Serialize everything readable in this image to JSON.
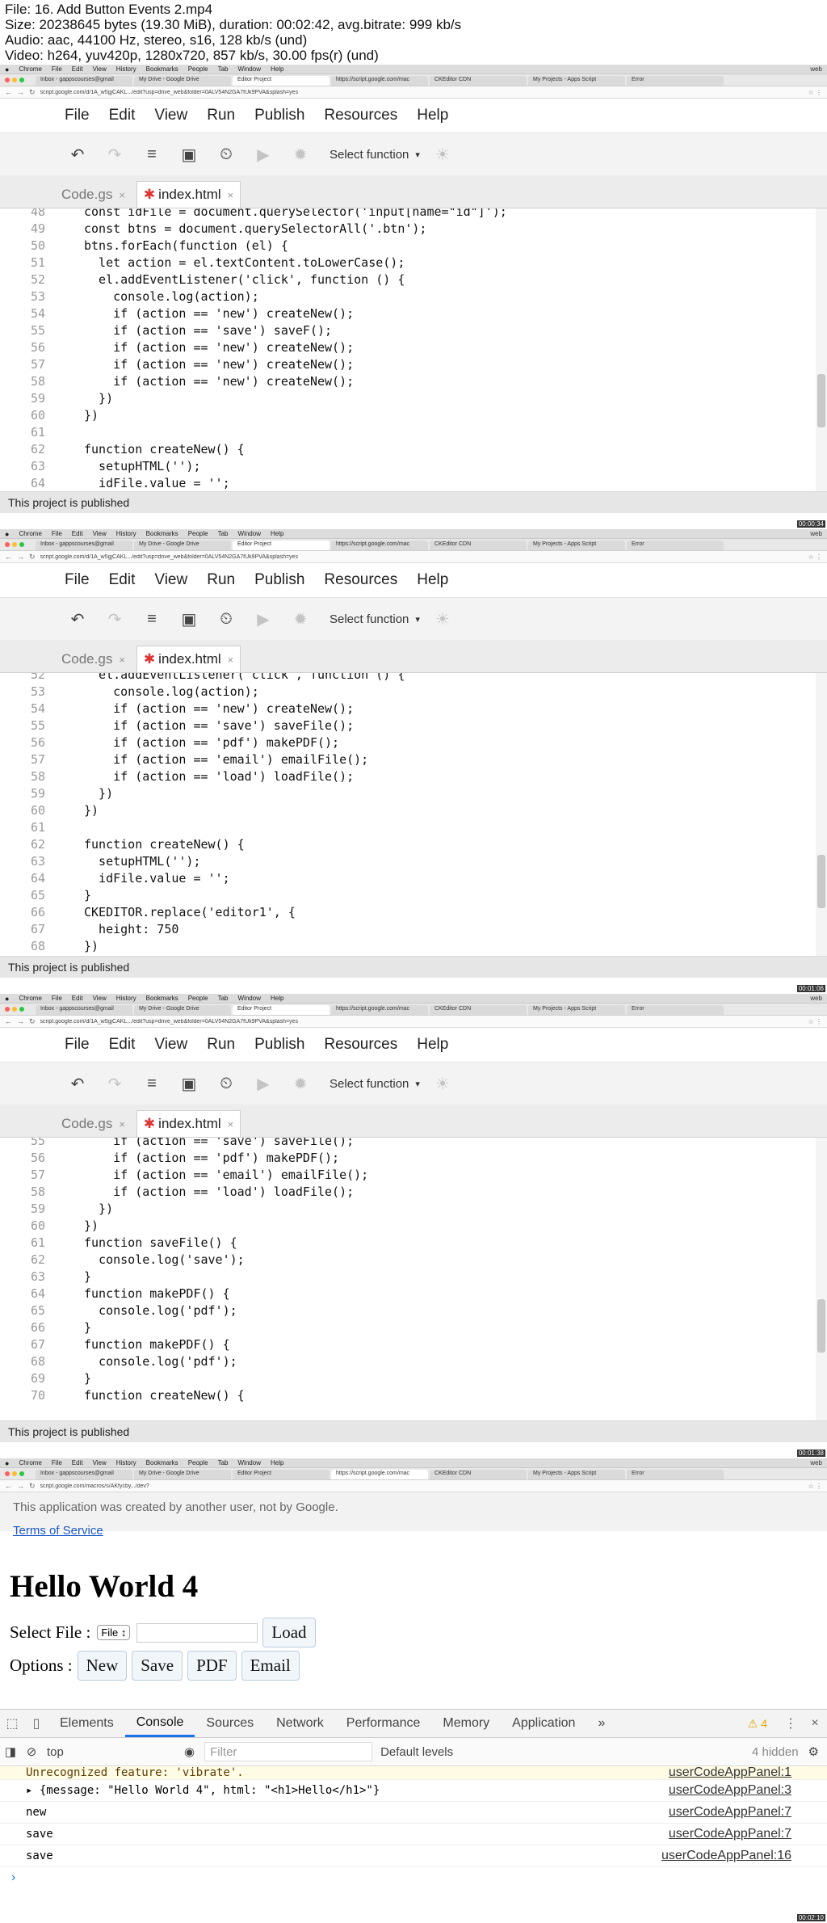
{
  "header": {
    "lines": [
      "File: 16. Add Button Events 2.mp4",
      "Size: 20238645 bytes (19.30 MiB), duration: 00:02:42, avg.bitrate: 999 kb/s",
      "Audio: aac, 44100 Hz, stereo, s16, 128 kb/s (und)",
      "Video: h264, yuv420p, 1280x720, 857 kb/s, 30.00 fps(r) (und)"
    ]
  },
  "macmenu": [
    "Chrome",
    "File",
    "Edit",
    "View",
    "History",
    "Bookmarks",
    "People",
    "Tab",
    "Window",
    "Help"
  ],
  "macright": "web",
  "browser_tabs": [
    "Inbox - gappscourses@gmail",
    "My Drive - Google Drive",
    "Editor Project",
    "https://script.google.com/mac",
    "CKEditor CDN",
    "My Projects - Apps Script",
    "Error"
  ],
  "editor_url": "script.google.com/d/1A_w5gjCAKL.../edit?usp=drive_web&folder=0ALV54N2GA7fUk9PVA&splash=yes",
  "app_url": "script.google.com/macros/s/AKfycby.../dev?",
  "menu": [
    "File",
    "Edit",
    "View",
    "Run",
    "Publish",
    "Resources",
    "Help"
  ],
  "toolbar": {
    "select_function": "Select function"
  },
  "file_tabs": {
    "code": "Code.gs",
    "index": "index.html"
  },
  "status_text": "This project is published",
  "frame_times": [
    "00:00:34",
    "00:01:06",
    "00:01:38",
    "00:02:10"
  ],
  "code_frames": [
    {
      "lines": [
        {
          "n": "48",
          "t": "const idFile = document.querySelector('input[name=\"id\"]');"
        },
        {
          "n": "49",
          "t": "const btns = document.querySelectorAll('.btn');"
        },
        {
          "n": "50",
          "t": "btns.forEach(function (el) {"
        },
        {
          "n": "51",
          "t": "  let action = el.textContent.toLowerCase();"
        },
        {
          "n": "52",
          "t": "  el.addEventListener('click', function () {"
        },
        {
          "n": "53",
          "t": "    console.log(action);"
        },
        {
          "n": "54",
          "t": "    if (action == 'new') createNew();"
        },
        {
          "n": "55",
          "t": "    if (action == 'save') saveF();"
        },
        {
          "n": "56",
          "t": "    if (action == 'new') createNew();"
        },
        {
          "n": "57",
          "t": "    if (action == 'new') createNew();"
        },
        {
          "n": "58",
          "t": "    if (action == 'new') createNew();"
        },
        {
          "n": "59",
          "t": "  })"
        },
        {
          "n": "60",
          "t": "})"
        },
        {
          "n": "61",
          "t": ""
        },
        {
          "n": "62",
          "t": "function createNew() {"
        },
        {
          "n": "63",
          "t": "  setupHTML('');"
        },
        {
          "n": "64",
          "t": "  idFile.value = '';"
        }
      ]
    },
    {
      "lines": [
        {
          "n": "52",
          "t": "  el.addEventListener('click', function () {"
        },
        {
          "n": "53",
          "t": "    console.log(action);"
        },
        {
          "n": "54",
          "t": "    if (action == 'new') createNew();"
        },
        {
          "n": "55",
          "t": "    if (action == 'save') saveFile();"
        },
        {
          "n": "56",
          "t": "    if (action == 'pdf') makePDF();"
        },
        {
          "n": "57",
          "t": "    if (action == 'email') emailFile();"
        },
        {
          "n": "58",
          "t": "    if (action == 'load') loadFile();"
        },
        {
          "n": "59",
          "t": "  })"
        },
        {
          "n": "60",
          "t": "})"
        },
        {
          "n": "61",
          "t": ""
        },
        {
          "n": "62",
          "t": "function createNew() {"
        },
        {
          "n": "63",
          "t": "  setupHTML('');"
        },
        {
          "n": "64",
          "t": "  idFile.value = '';"
        },
        {
          "n": "65",
          "t": "}"
        },
        {
          "n": "66",
          "t": "CKEDITOR.replace('editor1', {"
        },
        {
          "n": "67",
          "t": "  height: 750"
        },
        {
          "n": "68",
          "t": "})"
        }
      ]
    },
    {
      "lines": [
        {
          "n": "55",
          "t": "    if (action == 'save') saveFile();"
        },
        {
          "n": "56",
          "t": "    if (action == 'pdf') makePDF();"
        },
        {
          "n": "57",
          "t": "    if (action == 'email') emailFile();"
        },
        {
          "n": "58",
          "t": "    if (action == 'load') loadFile();"
        },
        {
          "n": "59",
          "t": "  })"
        },
        {
          "n": "60",
          "t": "})"
        },
        {
          "n": "61",
          "t": "function saveFile() {"
        },
        {
          "n": "62",
          "t": "  console.log('save');"
        },
        {
          "n": "63",
          "t": "}"
        },
        {
          "n": "64",
          "t": "function makePDF() {"
        },
        {
          "n": "65",
          "t": "  console.log('pdf');"
        },
        {
          "n": "66",
          "t": "}"
        },
        {
          "n": "67",
          "t": "function makePDF() {"
        },
        {
          "n": "68",
          "t": "  console.log('pdf');"
        },
        {
          "n": "69",
          "t": "}"
        },
        {
          "n": "70",
          "t": "function createNew() {"
        }
      ]
    }
  ],
  "app": {
    "notice": "This application was created by another user, not by Google.",
    "terms": "Terms of Service",
    "heading": "Hello World 4",
    "select_label": "Select File :",
    "select_value": "File",
    "load": "Load",
    "options_label": "Options :",
    "buttons": [
      "New",
      "Save",
      "PDF",
      "Email"
    ]
  },
  "devtools": {
    "tabs": [
      "Elements",
      "Console",
      "Sources",
      "Network",
      "Performance",
      "Memory",
      "Application"
    ],
    "more": "»",
    "warn_count": "4",
    "context": "top",
    "filter_placeholder": "Filter",
    "levels": "Default levels",
    "hidden": "4 hidden",
    "logs": [
      {
        "msg": "Unrecognized feature: 'vibrate'.",
        "src": "userCodeAppPanel:1",
        "warn": true
      },
      {
        "msg": "▸ {message: \"Hello World 4\", html: \"<h1>Hello</h1>\"}",
        "src": "userCodeAppPanel:3",
        "warn": false
      },
      {
        "msg": "new",
        "src": "userCodeAppPanel:7",
        "warn": false
      },
      {
        "msg": "save",
        "src": "userCodeAppPanel:7",
        "warn": false
      },
      {
        "msg": "save",
        "src": "userCodeAppPanel:16",
        "warn": false
      }
    ],
    "prompt": "›"
  }
}
